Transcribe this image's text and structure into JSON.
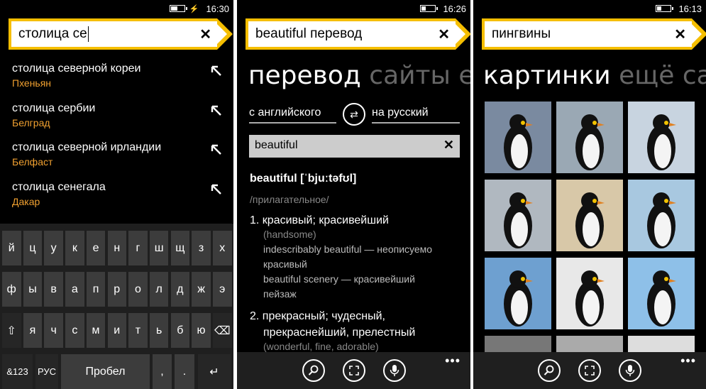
{
  "screen1": {
    "time": "16:30",
    "battery_level": 0.45,
    "search_text": "столица се",
    "suggestions": [
      {
        "query": "столица северной кореи",
        "answer": "Пхеньян"
      },
      {
        "query": "столица сербии",
        "answer": "Белград"
      },
      {
        "query": "столица северной ирландии",
        "answer": "Белфаст"
      },
      {
        "query": "столица сенегала",
        "answer": "Дакар"
      }
    ],
    "keyboard": {
      "row1": [
        "й",
        "ц",
        "у",
        "к",
        "е",
        "н",
        "г",
        "ш",
        "щ",
        "з",
        "х"
      ],
      "row2": [
        "ф",
        "ы",
        "в",
        "а",
        "п",
        "р",
        "о",
        "л",
        "д",
        "ж",
        "э"
      ],
      "row3": [
        "⇧",
        "я",
        "ч",
        "с",
        "м",
        "и",
        "т",
        "ь",
        "б",
        "ю",
        "⌫"
      ],
      "sym": "&123",
      "lang": "РУС",
      "space": "Пробел",
      "comma": ",",
      "period": ".",
      "enter": "↵"
    }
  },
  "screen2": {
    "time": "16:26",
    "battery_level": 0.3,
    "search_text": "beautiful перевод",
    "pivot": [
      "перевод",
      "сайты",
      "ещ"
    ],
    "from_lang": "с английского",
    "to_lang": "на русский",
    "input_text": "beautiful",
    "headword": "beautiful [ˈbjuːtəfʊl]",
    "pos": "/прилагательное/",
    "sense1_title": "1. красивый; красивейший",
    "sense1_note": "(handsome)",
    "sense1_ex1a": "indescribably beautiful — неописуемо",
    "sense1_ex1b": "красивый",
    "sense1_ex2a": "beautiful scenery — красивейший",
    "sense1_ex2b": "пейзаж",
    "sense2_title_a": "2. прекрасный; чудесный,",
    "sense2_title_b": "прекраснейший, прелестный",
    "sense2_note": "(wonderful, fine, adorable)",
    "more": "•••"
  },
  "screen3": {
    "time": "16:13",
    "battery_level": 0.3,
    "search_text": "пингвины",
    "pivot": [
      "картинки",
      "ещё",
      "сайт"
    ],
    "more": "•••"
  }
}
